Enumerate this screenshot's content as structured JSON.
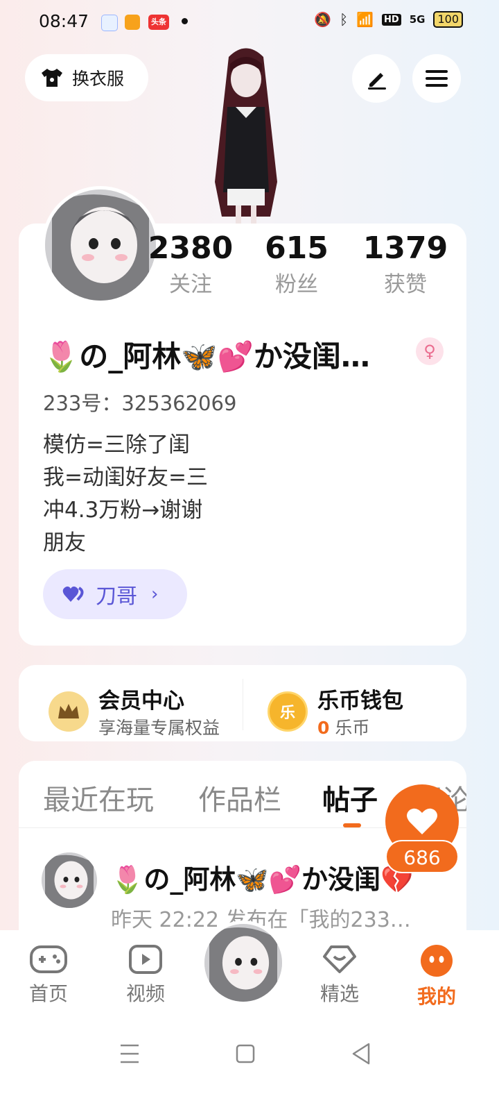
{
  "status_bar": {
    "time": "08:47",
    "app_label": "头条",
    "battery": "100",
    "network": "5G",
    "hd": "HD"
  },
  "header": {
    "outfit_label": "换衣服"
  },
  "profile": {
    "stats": [
      {
        "value": "2380",
        "label": "关注"
      },
      {
        "value": "615",
        "label": "粉丝"
      },
      {
        "value": "1379",
        "label": "获赞"
      }
    ],
    "username": "🌷の_阿林🦋💕か没闺…",
    "uid": "233号：325362069",
    "bio_lines": [
      "模仿=三除了闺",
      "我=动闺好友=三",
      "冲4.3万粉→谢谢",
      "朋友"
    ],
    "tag": "刀哥"
  },
  "member": {
    "vip_title": "会员中心",
    "vip_sub": "享海量专属权益",
    "wallet_title": "乐币钱包",
    "wallet_amount": "0",
    "wallet_unit": "乐币"
  },
  "tabs": [
    "最近在玩",
    "作品栏",
    "帖子",
    "评论"
  ],
  "post": {
    "name": "🌷の_阿林🦋💕か没闺💔",
    "meta": "昨天 22:22  发布在「我的233…"
  },
  "like_count": "686",
  "nav": {
    "home": "首页",
    "video": "视频",
    "featured": "精选",
    "mine": "我的"
  },
  "colors": {
    "accent": "#f26b1d",
    "tag_bg": "#ebe9ff",
    "tag_text": "#5a56d6"
  }
}
